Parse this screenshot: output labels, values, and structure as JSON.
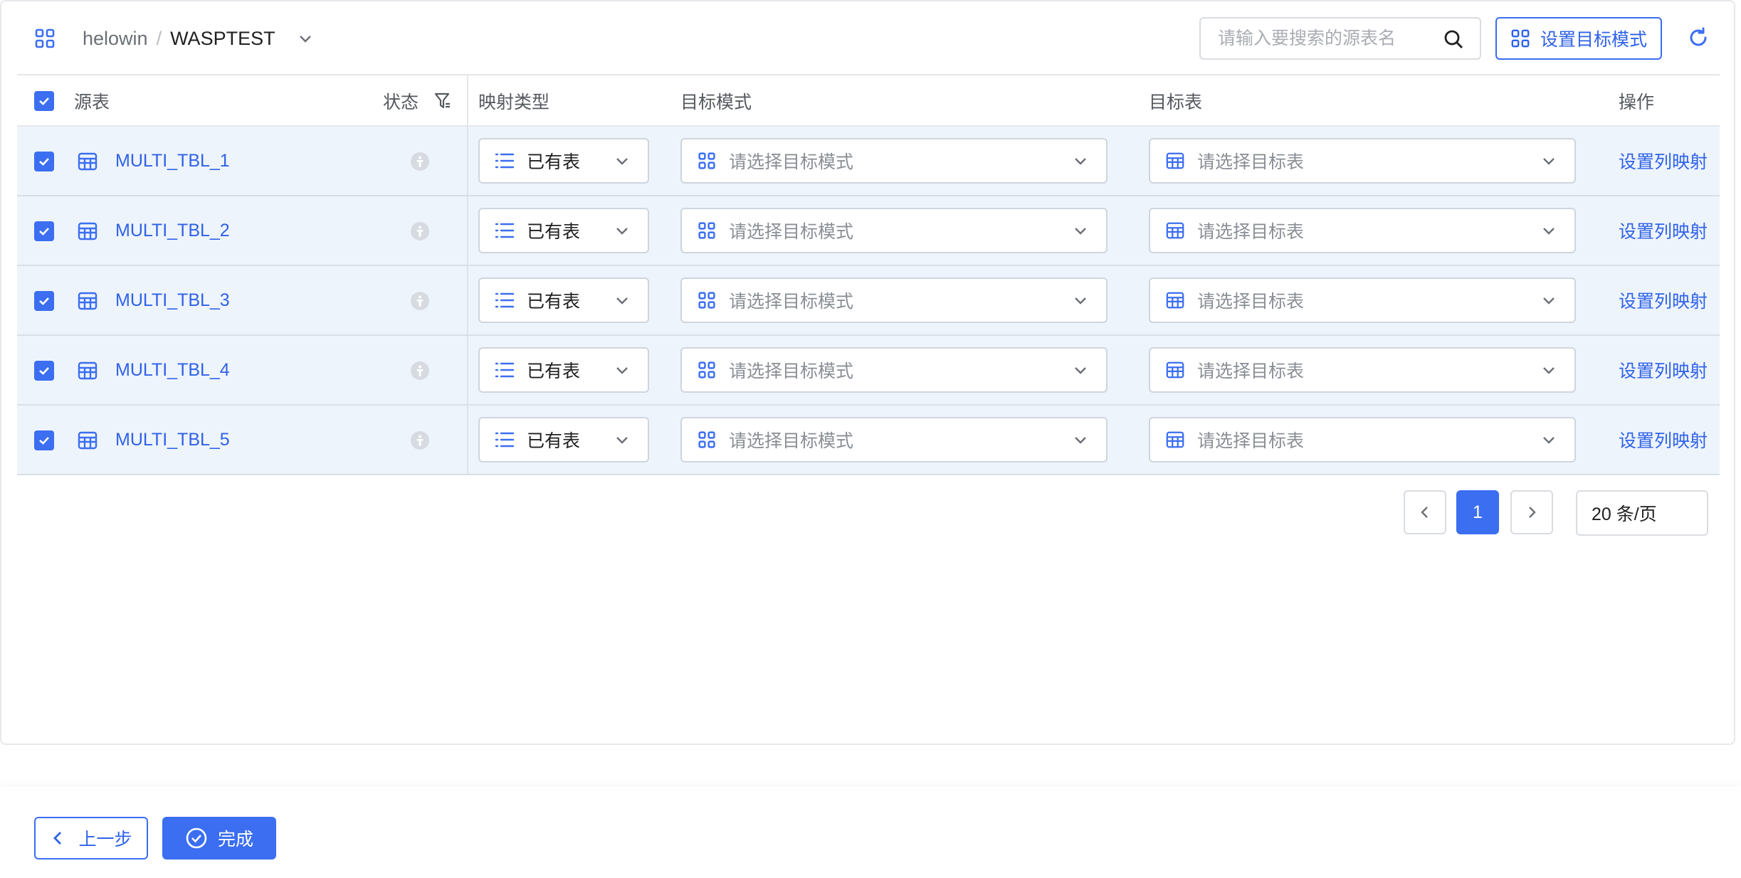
{
  "header": {
    "database": "helowin",
    "separator": "/",
    "schema": "WASPTEST",
    "search_placeholder": "请输入要搜索的源表名",
    "set_mode_label": "设置目标模式"
  },
  "table": {
    "columns": {
      "source": "源表",
      "status": "状态",
      "mapping_type": "映射类型",
      "target_schema": "目标模式",
      "target_table": "目标表",
      "action": "操作"
    },
    "rows": [
      {
        "name": "MULTI_TBL_1",
        "mapping_type": "已有表",
        "schema_placeholder": "请选择目标模式",
        "table_placeholder": "请选择目标表",
        "action": "设置列映射"
      },
      {
        "name": "MULTI_TBL_2",
        "mapping_type": "已有表",
        "schema_placeholder": "请选择目标模式",
        "table_placeholder": "请选择目标表",
        "action": "设置列映射"
      },
      {
        "name": "MULTI_TBL_3",
        "mapping_type": "已有表",
        "schema_placeholder": "请选择目标模式",
        "table_placeholder": "请选择目标表",
        "action": "设置列映射"
      },
      {
        "name": "MULTI_TBL_4",
        "mapping_type": "已有表",
        "schema_placeholder": "请选择目标模式",
        "table_placeholder": "请选择目标表",
        "action": "设置列映射"
      },
      {
        "name": "MULTI_TBL_5",
        "mapping_type": "已有表",
        "schema_placeholder": "请选择目标模式",
        "table_placeholder": "请选择目标表",
        "action": "设置列映射"
      }
    ]
  },
  "pagination": {
    "current_page": "1",
    "page_size": "20 条/页"
  },
  "footer": {
    "prev_label": "上一步",
    "done_label": "完成"
  },
  "colors": {
    "accent": "#3b6ef0",
    "link": "#2f62e8",
    "row_bg": "#eef4fc"
  },
  "icons": [
    "grid-icon",
    "chevron-down-icon",
    "search-icon",
    "refresh-icon",
    "table-icon",
    "info-icon",
    "filter-icon",
    "list-icon",
    "check-icon",
    "chevron-left-icon",
    "chevron-right-icon",
    "check-circle-icon"
  ]
}
